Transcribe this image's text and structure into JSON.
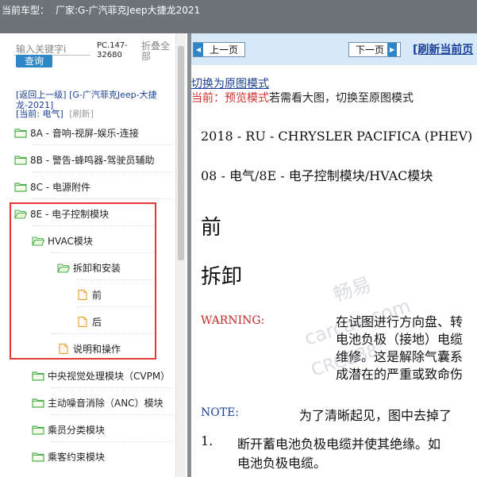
{
  "titlebar": {
    "vehicle_label": "当前车型：",
    "vehicle_value": "厂家:G-广汽菲克Jeep大捷龙2021"
  },
  "sidebar": {
    "search_placeholder": "输入关键字i",
    "query_label": "查询",
    "pc_code": "PC.147-32680",
    "collapse_all_label": "折叠全部",
    "back_link": "[返回上一级]  [G-广汽菲克Jeep-大捷龙-2021]",
    "current_label": "[当前: 电气]",
    "refresh_label": "[刷新]",
    "tree": [
      {
        "label": "8A - 音响-视屏-娱乐-连接",
        "type": "folder"
      },
      {
        "label": "8B - 警告-蜂鸣器-驾驶员辅助",
        "type": "folder"
      },
      {
        "label": "8C - 电源附件",
        "type": "folder"
      },
      {
        "label": "8E - 电子控制模块",
        "type": "folder"
      },
      {
        "label": "HVAC模块",
        "type": "folder"
      },
      {
        "label": "拆卸和安装",
        "type": "folder"
      },
      {
        "label": "前",
        "type": "file"
      },
      {
        "label": "后",
        "type": "file"
      },
      {
        "label": "说明和操作",
        "type": "file"
      },
      {
        "label": "中央视觉处理模块（CVPM）",
        "type": "folder"
      },
      {
        "label": "主动噪音消除（ANC）模块",
        "type": "folder"
      },
      {
        "label": "乘员分类模块",
        "type": "folder"
      },
      {
        "label": "乘客约束模块",
        "type": "folder"
      }
    ]
  },
  "viewer": {
    "prev_label": "上一页",
    "next_label": "下一页",
    "refresh_page_label": "[刷新当前页",
    "switch_link": "切换为原图模式",
    "mode_prefix": "当前：预览模式",
    "mode_suffix": "若需看大图，切换至原图模式"
  },
  "document": {
    "heading1": "2018 - RU - CHRYSLER PACIFICA (PHEV)",
    "heading2": "08 - 电气/8E - 电子控制模块/HVAC模块",
    "section_front": "前",
    "section_removal": "拆卸",
    "warning_label": "WARNING:",
    "warning_lines": [
      "在试图进行方向盘、转",
      "电池负极（接地）电缆",
      "维修。这是解除气囊系",
      "成潜在的严重或致命伤"
    ],
    "note_label": "NOTE:",
    "note_text": "为了清晰起见，图中去掉了",
    "step1_number": "1.",
    "step1_lines": [
      "断开蓄电池负极电缆并使其绝缘。如",
      "电池负极电缆。"
    ],
    "watermarks": [
      "畅易",
      "carcae.com",
      "CRC888"
    ]
  },
  "colors": {
    "titlebar": "#6d7379",
    "accent_blue": "#2f86c7",
    "link_blue": "#1a3f9a",
    "warning_red": "#c62828",
    "highlight_red": "#e53935"
  }
}
